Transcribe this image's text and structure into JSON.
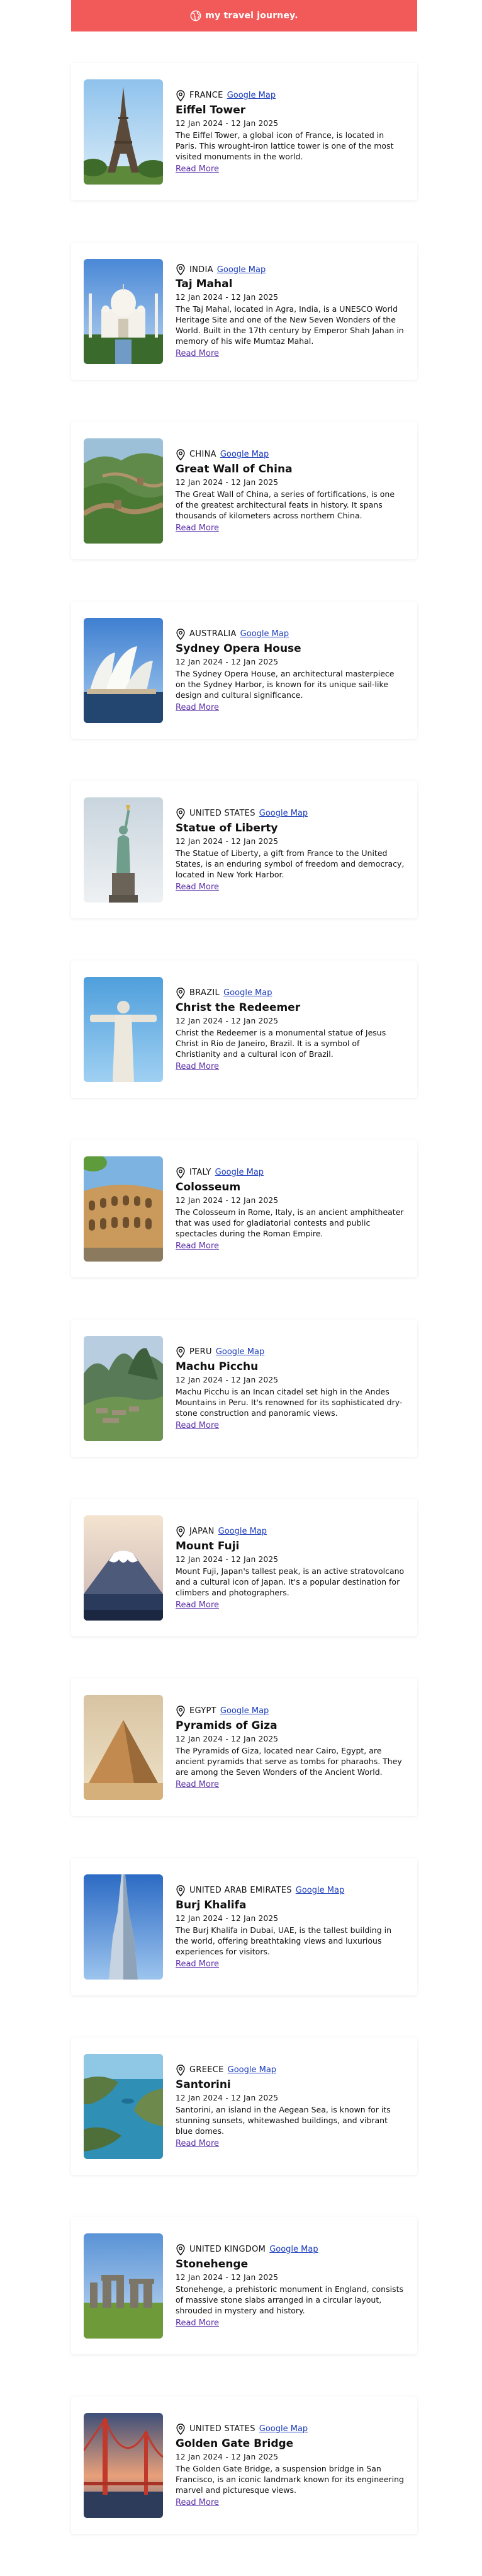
{
  "header": {
    "title": "my travel journey."
  },
  "common": {
    "map_label": "Google Map",
    "more_label": "Read More"
  },
  "entries": [
    {
      "country": "FRANCE",
      "name": "Eiffel Tower",
      "dates": "12 Jan 2024 - 12 Jan 2025",
      "desc": "The Eiffel Tower, a global icon of France, is located in Paris. This wrought-iron lattice tower is one of the most visited monuments in the world."
    },
    {
      "country": "INDIA",
      "name": "Taj Mahal",
      "dates": "12 Jan 2024 - 12 Jan 2025",
      "desc": "The Taj Mahal, located in Agra, India, is a UNESCO World Heritage Site and one of the New Seven Wonders of the World. Built in the 17th century by Emperor Shah Jahan in memory of his wife Mumtaz Mahal."
    },
    {
      "country": "CHINA",
      "name": "Great Wall of China",
      "dates": "12 Jan 2024 - 12 Jan 2025",
      "desc": "The Great Wall of China, a series of fortifications, is one of the greatest architectural feats in history. It spans thousands of kilometers across northern China."
    },
    {
      "country": "AUSTRALIA",
      "name": "Sydney Opera House",
      "dates": "12 Jan 2024 - 12 Jan 2025",
      "desc": "The Sydney Opera House, an architectural masterpiece on the Sydney Harbor, is known for its unique sail-like design and cultural significance."
    },
    {
      "country": "UNITED STATES",
      "name": "Statue of Liberty",
      "dates": "12 Jan 2024 - 12 Jan 2025",
      "desc": "The Statue of Liberty, a gift from France to the United States, is an enduring symbol of freedom and democracy, located in New York Harbor."
    },
    {
      "country": "BRAZIL",
      "name": "Christ the Redeemer",
      "dates": "12 Jan 2024 - 12 Jan 2025",
      "desc": "Christ the Redeemer is a monumental statue of Jesus Christ in Rio de Janeiro, Brazil. It is a symbol of Christianity and a cultural icon of Brazil."
    },
    {
      "country": "ITALY",
      "name": "Colosseum",
      "dates": "12 Jan 2024 - 12 Jan 2025",
      "desc": "The Colosseum in Rome, Italy, is an ancient amphitheater that was used for gladiatorial contests and public spectacles during the Roman Empire."
    },
    {
      "country": "PERU",
      "name": "Machu Picchu",
      "dates": "12 Jan 2024 - 12 Jan 2025",
      "desc": "Machu Picchu is an Incan citadel set high in the Andes Mountains in Peru. It's renowned for its sophisticated dry-stone construction and panoramic views."
    },
    {
      "country": "JAPAN",
      "name": "Mount Fuji",
      "dates": "12 Jan 2024 - 12 Jan 2025",
      "desc": "Mount Fuji, Japan's tallest peak, is an active stratovolcano and a cultural icon of Japan. It's a popular destination for climbers and photographers."
    },
    {
      "country": "EGYPT",
      "name": "Pyramids of Giza",
      "dates": "12 Jan 2024 - 12 Jan 2025",
      "desc": "The Pyramids of Giza, located near Cairo, Egypt, are ancient pyramids that serve as tombs for pharaohs. They are among the Seven Wonders of the Ancient World."
    },
    {
      "country": "UNITED ARAB EMIRATES",
      "name": "Burj Khalifa",
      "dates": "12 Jan 2024 - 12 Jan 2025",
      "desc": "The Burj Khalifa in Dubai, UAE, is the tallest building in the world, offering breathtaking views and luxurious experiences for visitors."
    },
    {
      "country": "GREECE",
      "name": "Santorini",
      "dates": "12 Jan 2024 - 12 Jan 2025",
      "desc": "Santorini, an island in the Aegean Sea, is known for its stunning sunsets, whitewashed buildings, and vibrant blue domes."
    },
    {
      "country": "UNITED KINGDOM",
      "name": "Stonehenge",
      "dates": "12 Jan 2024 - 12 Jan 2025",
      "desc": "Stonehenge, a prehistoric monument in England, consists of massive stone slabs arranged in a circular layout, shrouded in mystery and history."
    },
    {
      "country": "UNITED STATES",
      "name": "Golden Gate Bridge",
      "dates": "12 Jan 2024 - 12 Jan 2025",
      "desc": "The Golden Gate Bridge, a suspension bridge in San Francisco, is an iconic landmark known for its engineering marvel and picturesque views."
    }
  ]
}
